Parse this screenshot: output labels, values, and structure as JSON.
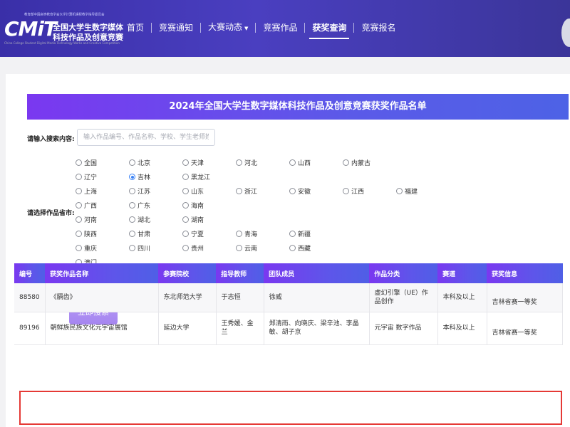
{
  "header": {
    "logo_mark": "CMiT",
    "logo_tiny": "教育部中国高等教育学会大学计算机课程教学指导委员会",
    "logo_line1": "全国大学生数字媒体",
    "logo_line2": "科技作品及创意竞赛",
    "logo_sub": "China College Student Digital Media Technology Works and Creative Competition",
    "nav": [
      {
        "label": "首页"
      },
      {
        "label": "竞赛通知"
      },
      {
        "label": "大赛动态"
      },
      {
        "label": "竞赛作品"
      },
      {
        "label": "获奖查询"
      },
      {
        "label": "竞赛报名"
      }
    ]
  },
  "banner_title": "2024年全国大学生数字媒体科技作品及创意竞赛获奖作品名单",
  "search": {
    "label": "请输入搜索内容:",
    "placeholder": "输入作品编号、作品名称、学校、学生老师姓名",
    "value": ""
  },
  "province": {
    "label": "请选择作品省市:",
    "selected": "吉林",
    "rows": [
      [
        "全国",
        "北京",
        "天津",
        "河北",
        "山西",
        "内蒙古"
      ],
      [
        "辽宁",
        "吉林",
        "黑龙江"
      ],
      [
        "上海",
        "江苏",
        "山东",
        "浙江",
        "安徽",
        "江西",
        "福建"
      ],
      [
        "广西",
        "广东",
        "海南"
      ],
      [
        "河南",
        "湖北",
        "湖南"
      ],
      [
        "陕西",
        "甘肃",
        "宁夏",
        "青海",
        "新疆"
      ],
      [
        "重庆",
        "四川",
        "贵州",
        "云南",
        "西藏"
      ],
      [
        "澳门"
      ]
    ]
  },
  "search_button": "立即搜索",
  "table": {
    "headers": [
      "编号",
      "获奖作品名称",
      "参赛院校",
      "指导教师",
      "团队成员",
      "作品分类",
      "赛道",
      "获奖信息"
    ],
    "rows": [
      [
        "88580",
        "《膈齿》",
        "东北师范大学",
        "于志恒",
        "徐威",
        "虚幻引擎（UE）作品创作",
        "本科及以上",
        "吉林省赛一等奖"
      ],
      [
        "89196",
        "朝鲜族民族文化元宇宙展馆",
        "延边大学",
        "王秀媛、金兰",
        "郑清雨、向晓庆、梁辛池、李晶敏、胡子京",
        "元宇宙 数字作品",
        "本科及以上",
        "吉林省赛一等奖"
      ]
    ]
  }
}
